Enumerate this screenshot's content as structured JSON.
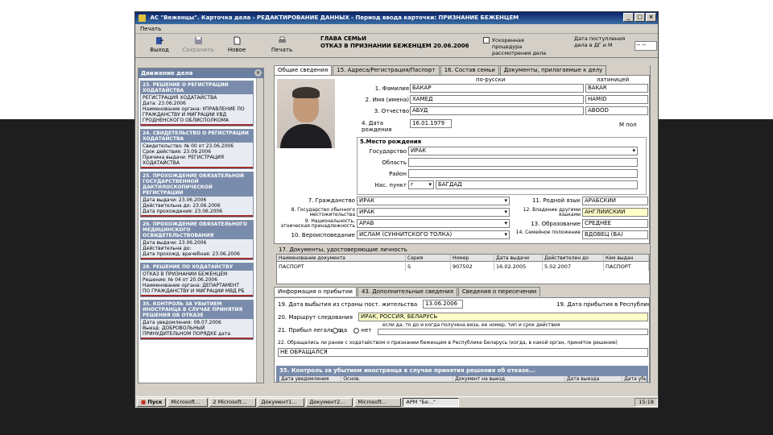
{
  "window": {
    "title": "АС \"Beженцы\". Карточка дела - РЕДАКТИРОВАНИЕ ДАННЫХ - Период ввода карточки: ПРИЗНАНИЕ БЕЖЕНЦЕМ",
    "controls": [
      "_",
      "□",
      "×"
    ]
  },
  "menu": {
    "item": "Печать"
  },
  "toolbar": {
    "items": [
      {
        "label": "Выход",
        "icon": "exit-icon"
      },
      {
        "label": "Сохранить",
        "icon": "save-icon"
      },
      {
        "label": "Новое",
        "icon": "new-icon"
      },
      {
        "label": "Печать",
        "icon": "print-icon"
      }
    ],
    "heading_line1": "ГЛАВА СЕМЬИ",
    "heading_line2": "ОТКАЗ В ПРИЗНАНИИ БЕЖЕНЦЕМ",
    "heading_date": "20.06.2006",
    "accel_label": "Ускоренная процедура рассмотрения дела",
    "arrival_label": "Дата поступления дела в ДГ и М",
    "arrival_value": "-- --"
  },
  "left_panel": {
    "title": "Движение дела",
    "cards": [
      {
        "header": "23. РЕШЕНИЕ О РЕГИСТРАЦИИ ХОДАТАЙСТВА",
        "lines": [
          "РЕГИСТРАЦИЯ ХОДАТАЙСТВА",
          "Дата: 23.06.2006",
          "Наименование органа: УПРАВЛЕНИЕ ПО ГРАЖДАНСТВУ И МИГРАЦИИ УВД",
          "ГРОДНЕНСКОГО ОБЛИСПОЛКОМА"
        ]
      },
      {
        "header": "24. СВИДЕТЕЛЬСТВО О РЕГИСТРАЦИИ ХОДАТАЙСТВА",
        "lines": [
          "Свидетельство: № 00 от 23.06.2006",
          "Срок действия: 23.09.2006",
          "Причина выдачи: РЕГИСТРАЦИЯ ХОДАТАЙСТВА"
        ]
      },
      {
        "header": "25. ПРОХОЖДЕНИЕ ОБЯЗАТЕЛЬНОЙ ГОСУДАРСТВЕННОЙ ДАКТИЛОСКОПИЧЕСКОЙ РЕГИСТРАЦИИ",
        "lines": [
          "Дата выдачи: 23.06.2006",
          "Действительна до: 23.06.2006",
          "Дата прохождения: 23.06.2006"
        ]
      },
      {
        "header": "26. ПРОХОЖДЕНИЕ ОБЯЗАТЕЛЬНОГО МЕДИЦИНСКОГО ОСВИДЕТЕЛЬСТВОВАНИЯ",
        "lines": [
          "Дата выдачи: 23.06.2006",
          "Действительна до:",
          "Дата прохожд. врачебная: 23.06.2006"
        ]
      },
      {
        "header": "28. РЕШЕНИЕ ПО ХОДАТАЙСТВУ",
        "lines": [
          "ОТКАЗ В ПРИЗНАНИИ БЕЖЕНЦЕМ",
          "Решение: № 04 от 20.06.2006",
          "Наименование органа: ДЕПАРТАМЕНТ",
          "ПО ГРАЖДАНСТВУ И МИГРАЦИИ МВД РБ"
        ]
      },
      {
        "header": "35. КОНТРОЛЬ ЗА УБЫТИЕМ ИНОСТРАНЦА В СЛУЧАЕ ПРИНЯТИЯ РЕШЕНИЯ ОБ ОТКАЗЕ",
        "lines": [
          "Дата уведомления: 08.07.2006",
          "Выезд: ДОБРОВОЛЬНЫЙ",
          "ПРИНУДИТЕЛЬНОМ ПОРЯДКЕ дата"
        ]
      }
    ]
  },
  "tabs_top": [
    "Общие сведения",
    "15. Адреса/Регистрация/Паспорт",
    "16. Состав семьи",
    "Документы, прилагаемые к делу"
  ],
  "form": {
    "col_ru": "по-русски",
    "col_lat": "латиницей",
    "fields": [
      {
        "num": "1.",
        "label": "Фамилия",
        "ru": "БАКАР",
        "lat": "BAKAR"
      },
      {
        "num": "2.",
        "label": "Имя (имена)",
        "ru": "ХАМЕД",
        "lat": "HAMID"
      },
      {
        "num": "3.",
        "label": "Отчество",
        "ru": "АБУД",
        "lat": "ABOOD"
      }
    ],
    "birth_label": "4. Дата рождения",
    "birth_value": "16.01.1979",
    "gender_label": "пол",
    "gender_value": "М",
    "place_title": "5.Место рождения",
    "place_fields": [
      {
        "label": "Государство",
        "value": "ИРАК"
      },
      {
        "label": "Область",
        "value": ""
      },
      {
        "label": "Район",
        "value": ""
      },
      {
        "label": "Нас. пункт",
        "value": "БАГДАД",
        "prefix": "г"
      }
    ],
    "left_fields": [
      {
        "label": "7. Гражданство",
        "value": "ИРАК"
      },
      {
        "label": "8. Государство обычного местожительства",
        "value": "ИРАК"
      },
      {
        "label": "9. Национальность, этническая принадлежность",
        "value": "АРАБ"
      },
      {
        "label": "10. Вероисповедание",
        "value": "ИСЛАМ (СУННИТСКОГО ТОЛКА)"
      }
    ],
    "right_fields": [
      {
        "label": "11. Родной язык",
        "value": "АРАБСКИЙ"
      },
      {
        "label": "12. Владение другими языками",
        "value": "АНГЛИЙСКИЙ"
      },
      {
        "label": "13. Образование",
        "value": "СРЕДНЕЕ"
      },
      {
        "label": "14. Семейное положение",
        "value": "ВДОВЕЦ (ВА)"
      }
    ],
    "docs_title": "17. Документы, удостоверяющие личность",
    "docs_columns": [
      "Наименование документа",
      "Серия",
      "Номер",
      "Дата выдачи",
      "Действителен до",
      "Кем выдан"
    ],
    "docs_rows": [
      [
        "ПАСПОРТ",
        "S",
        "907502",
        "16.02.2005",
        "5.02.2007",
        "ПАСПОРТ"
      ]
    ]
  },
  "tabs_bottom": [
    "Информация о прибытии",
    "43. Дополнительные сведения",
    "Сведения о пересечении"
  ],
  "form2": {
    "depart_label": "19. Дата выбытия из страны пост. жительства",
    "depart_value": "13.06.2006",
    "arrive_label": "19. Дата прибытия в Республику",
    "route_label": "20. Маршрут следования",
    "route_value": "ИРАК, РОССИЯ, БЕЛАРУСЬ",
    "legal_label": "21. Прибыл легально",
    "legal_yes": "да",
    "legal_no": "нет",
    "legal_hint": "если да, то до и когда получена виза, ее номер, тип и срок действия",
    "appeal_label": "22. Обращались ли ранее с ходатайством о признании беженцем в Республике Беларусь (когда, в какой орган, принятое решение)",
    "appeal_value": "НЕ ОБРАЩАЛСЯ",
    "strip_title": "35. Контроль за убытием иностранца в случае принятия решения об отказе...",
    "strip_columns": [
      "Дата уведомления",
      "Основ.",
      "Документ на выезд",
      "Дата выезда",
      "Дата убытия"
    ]
  },
  "taskbar": {
    "start": "Пуск",
    "tasks": [
      "Microsoft...",
      "2 Microsoft...",
      "Документ1...",
      "Документ2...",
      "Microsoft...",
      "АРМ \"Бе...\""
    ],
    "clock": "15:18"
  }
}
